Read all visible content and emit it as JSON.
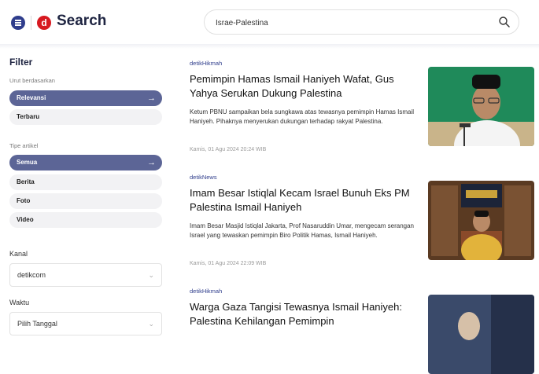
{
  "header": {
    "brand_logo_letter": "d",
    "brand_title": "Search",
    "search_value": "Israe-Palestina"
  },
  "sidebar": {
    "filter_title": "Filter",
    "sort_label": "Urut berdasarkan",
    "sort_options": [
      "Relevansi",
      "Terbaru"
    ],
    "type_label": "Tipe artikel",
    "type_options": [
      "Semua",
      "Berita",
      "Foto",
      "Video"
    ],
    "channel_label": "Kanal",
    "channel_value": "detikcom",
    "time_label": "Waktu",
    "time_value": "Pilih Tanggal"
  },
  "articles": [
    {
      "source": "detikHikmah",
      "title": "Pemimpin Hamas Ismail Haniyeh Wafat, Gus Yahya Serukan Dukung Palestina",
      "snippet": "Ketum PBNU sampaikan bela sungkawa atas tewasnya pemimpin Hamas Ismail Haniyeh. Pihaknya menyerukan dukungan terhadap rakyat Palestina.",
      "date": "Kamis, 01 Agu 2024 20:24 WIB"
    },
    {
      "source": "detikNews",
      "title": "Imam Besar Istiqlal Kecam Israel Bunuh Eks PM Palestina Ismail Haniyeh",
      "snippet": "Imam Besar Masjid Istiqlal Jakarta, Prof Nasaruddin Umar, mengecam serangan Israel yang tewaskan pemimpin Biro Politik Hamas, Ismail Haniyeh.",
      "date": "Kamis, 01 Agu 2024 22:09 WIB"
    },
    {
      "source": "detikHikmah",
      "title": "Warga Gaza Tangisi Tewasnya Ismail Haniyeh: Palestina Kehilangan Pemimpin"
    }
  ]
}
